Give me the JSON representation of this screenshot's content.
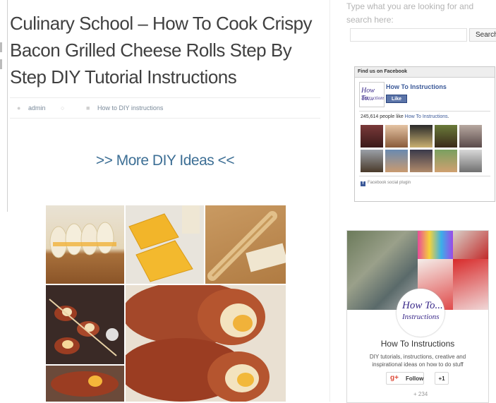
{
  "post": {
    "title": "Culinary School – How To Cook Crispy Bacon Grilled Cheese Rolls Step By Step DIY Tutorial Instructions",
    "author": "admin",
    "category": "How to DIY instructions",
    "more_link": ">> More DIY Ideas <<"
  },
  "sidebar": {
    "search": {
      "label": "Type what you are looking for and search here:",
      "placeholder": "",
      "button": "Search"
    },
    "facebook": {
      "header": "Find us on Facebook",
      "logo_line1": "How To...",
      "logo_line2": "Instructions",
      "page_name": "How To Instructions",
      "like_button": "Like",
      "count_prefix": "245,614 people like ",
      "count_link": "How To Instructions",
      "count_suffix": ".",
      "plugin_label": "Facebook social plugin"
    },
    "gplus": {
      "avatar_line1": "How To...",
      "avatar_line2": "Instructions",
      "name": "How To Instructions",
      "description": "DIY tutorials, instructions, creative and inspirational ideas on how to do stuff",
      "follow_button": "Follow",
      "plus_one": "+1",
      "count": "+ 234"
    }
  },
  "colors": {
    "link_blue": "#3d6f95",
    "facebook_blue": "#3b5998",
    "gplus_red": "#dd4b39"
  }
}
